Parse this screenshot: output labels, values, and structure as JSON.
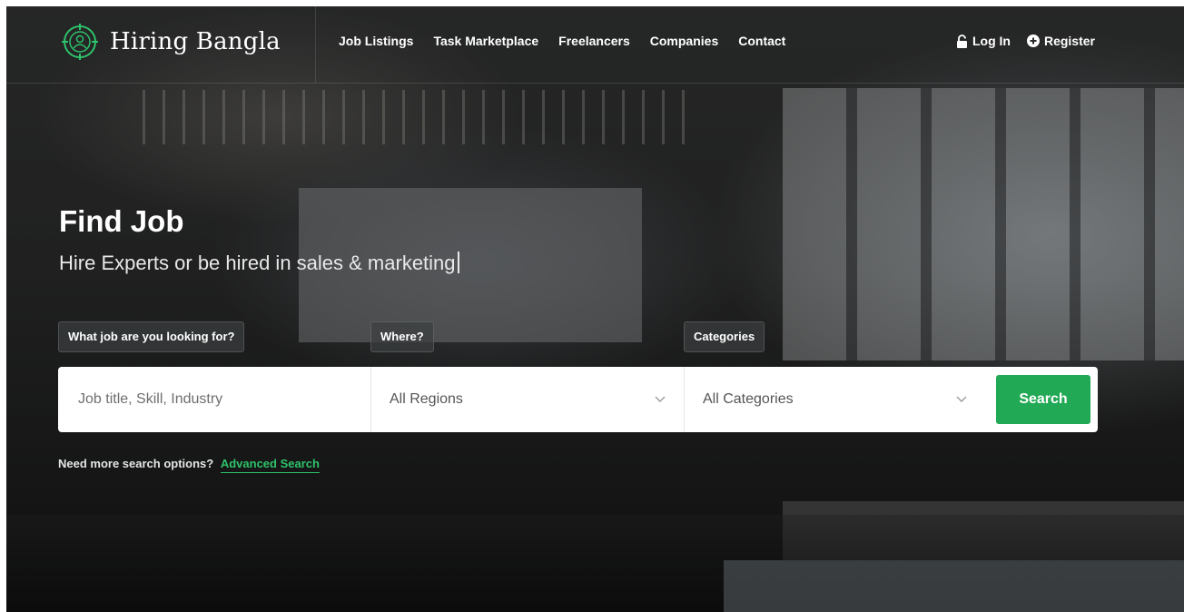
{
  "colors": {
    "accent": "#21a955",
    "link": "#2ec26a",
    "text_on_dark": "#ffffff"
  },
  "brand": {
    "name": "Hiring Bangla",
    "icon": "target-person-logo-icon"
  },
  "nav": {
    "items": [
      {
        "label": "Job Listings"
      },
      {
        "label": "Task Marketplace"
      },
      {
        "label": "Freelancers"
      },
      {
        "label": "Companies"
      },
      {
        "label": "Contact"
      }
    ]
  },
  "auth": {
    "login": {
      "label": "Log In",
      "icon": "lock-icon"
    },
    "register": {
      "label": "Register",
      "icon": "plus-circle-icon"
    }
  },
  "hero": {
    "title": "Find Job",
    "subtitle": "Hire Experts or be hired in sales & marketing"
  },
  "search": {
    "keyword": {
      "label": "What job are you looking for?",
      "placeholder": "Job title, Skill, Industry",
      "value": ""
    },
    "region": {
      "label": "Where?",
      "selected": "All Regions"
    },
    "category": {
      "label": "Categories",
      "selected": "All Categories"
    },
    "button_label": "Search"
  },
  "advanced": {
    "prompt": "Need more search options?",
    "link_label": "Advanced Search"
  }
}
